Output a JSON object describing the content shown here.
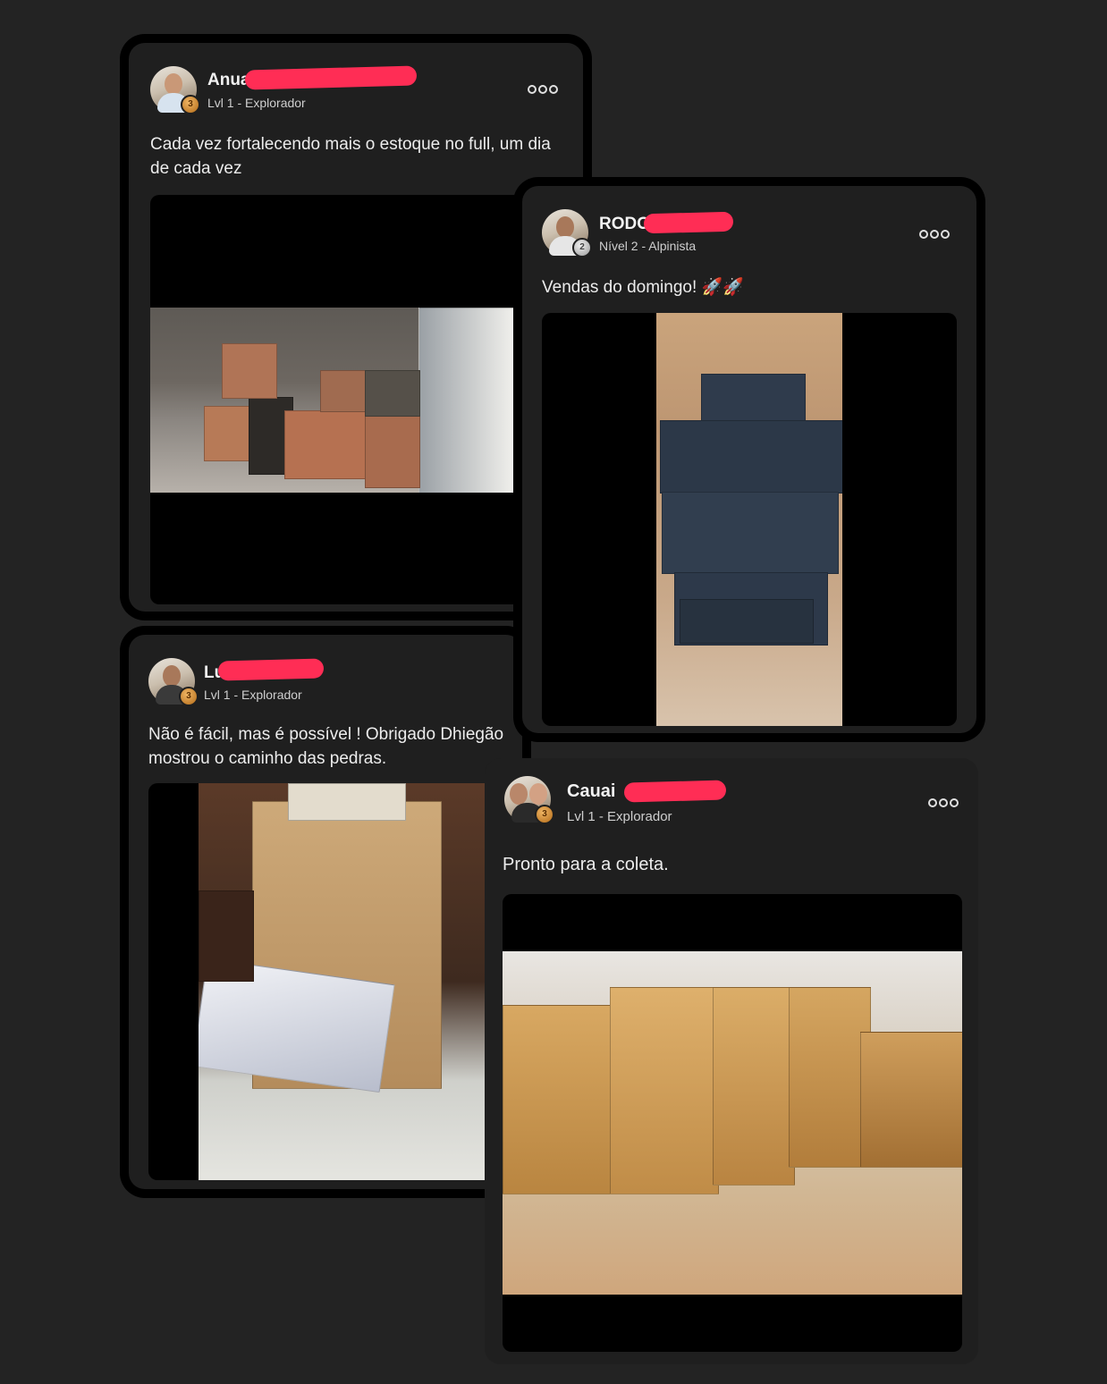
{
  "posts": [
    {
      "name_visible": "Anua",
      "level": "Lvl 1 - Explorador",
      "text": "Cada vez fortalecendo mais o estoque no full,  um dia de cada vez",
      "badge_icon": "bronze-medal-icon"
    },
    {
      "name_visible": "RODO",
      "level": "Nível 2 - Alpinista",
      "text": "Vendas do domingo! 🚀🚀",
      "badge_icon": "silver-medal-icon"
    },
    {
      "name_visible": "Lu",
      "level": "Lvl 1 - Explorador",
      "text": "Não é fácil, mas é possível ! Obrigado Dhiegão mostrou o caminho das pedras.",
      "badge_icon": "bronze-medal-icon"
    },
    {
      "name_visible": "Cauai",
      "level": "Lvl 1 - Explorador",
      "text": "Pronto para a coleta.",
      "badge_icon": "bronze-medal-icon"
    }
  ],
  "badges": {
    "bronze": "3",
    "silver": "2"
  },
  "colors": {
    "background": "#232323",
    "card": "#1f1f1f",
    "redaction": "#ff2d55"
  }
}
